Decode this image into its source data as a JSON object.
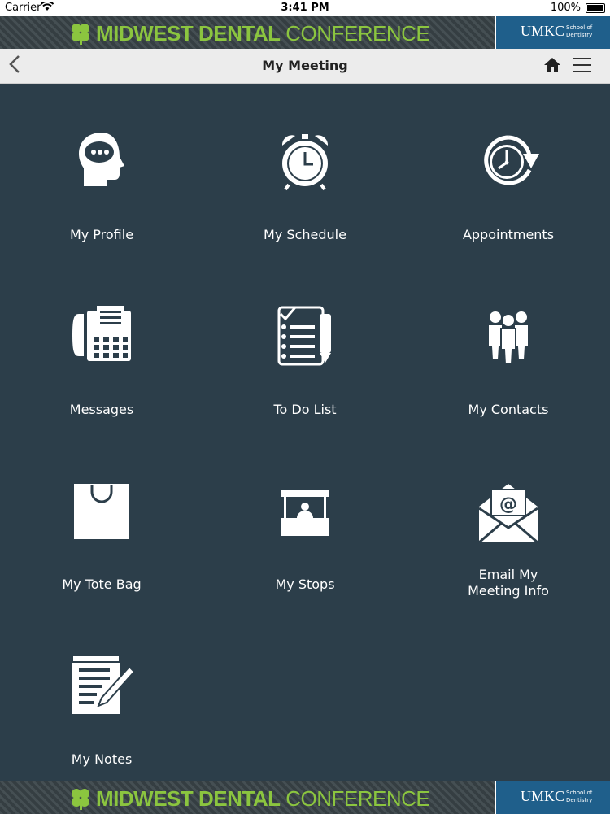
{
  "status_bar": {
    "carrier": "Carrier",
    "time": "3:41 PM",
    "battery": "100%"
  },
  "banner": {
    "title_bold": "MIDWEST DENTAL",
    "title_light": "CONFERENCE",
    "partner": "UMKC",
    "partner_sub": "School of Dentistry"
  },
  "navbar": {
    "title": "My Meeting"
  },
  "tiles": [
    {
      "label": "My Profile",
      "icon": "profile-head-icon"
    },
    {
      "label": "My Schedule",
      "icon": "alarm-clock-icon"
    },
    {
      "label": "Appointments",
      "icon": "clock-arrow-icon"
    },
    {
      "label": "Messages",
      "icon": "fax-phone-icon"
    },
    {
      "label": "To Do List",
      "icon": "checklist-icon"
    },
    {
      "label": "My Contacts",
      "icon": "people-icon"
    },
    {
      "label": "My Tote Bag",
      "icon": "tote-bag-icon"
    },
    {
      "label": "My Stops",
      "icon": "booth-icon"
    },
    {
      "label": "Email My Meeting Info",
      "icon": "email-icon",
      "label_line1": "Email My",
      "label_line2": "Meeting Info"
    },
    {
      "label": "My Notes",
      "icon": "notes-icon"
    }
  ],
  "colors": {
    "background": "#2c3e4a",
    "brand_green": "#8bc53f",
    "umkc_blue": "#1f5f8b"
  }
}
